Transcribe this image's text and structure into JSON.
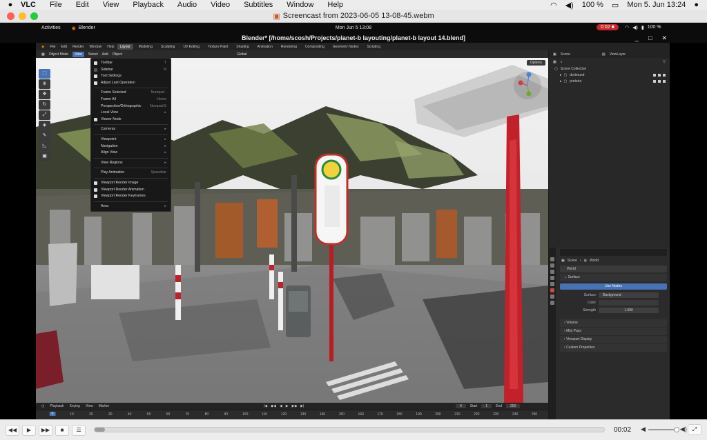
{
  "mac_menubar": {
    "app_name": "VLC",
    "menus": [
      "File",
      "Edit",
      "View",
      "Playback",
      "Audio",
      "Video",
      "Subtitles",
      "Window",
      "Help"
    ],
    "datetime": "Mon 5. Jun  13:24",
    "battery": "100 %"
  },
  "vlc_window": {
    "title": "Screencast from 2023-06-05 13-08-45.webm"
  },
  "gnome_bar": {
    "activities": "Activities",
    "app": "Blender",
    "clock": "Mon Jun 5  13:08",
    "recording": "0:02 ■",
    "battery": "100 %"
  },
  "blender": {
    "title": "Blender* [/home/scosh/Projects/planet-b layouting/planet-b layout 14.blend]",
    "top_menus": [
      "File",
      "Edit",
      "Render",
      "Window",
      "Help"
    ],
    "workspaces": [
      "Layout",
      "Modeling",
      "Sculpting",
      "UV Editing",
      "Texture Paint",
      "Shading",
      "Animation",
      "Rendering",
      "Compositing",
      "Geometry Nodes",
      "Scripting"
    ],
    "active_workspace": "Layout",
    "viewport_header": {
      "mode": "Object Mode",
      "menus": [
        "View",
        "Select",
        "Add",
        "Object"
      ],
      "orientation": "Global",
      "options": "Options"
    },
    "view_menu": {
      "items": [
        {
          "label": "Toolbar",
          "shortcut": "T",
          "check": true
        },
        {
          "label": "Sidebar",
          "shortcut": "N",
          "check": false
        },
        {
          "label": "Tool Settings",
          "shortcut": "",
          "check": true
        },
        {
          "label": "Adjust Last Operation",
          "shortcut": "",
          "check": true
        },
        {
          "label": "Frame Selected",
          "shortcut": "Numpad .",
          "check": null
        },
        {
          "label": "Frame All",
          "shortcut": "Home",
          "check": null
        },
        {
          "label": "Perspective/Orthographic",
          "shortcut": "Numpad 5",
          "check": null
        },
        {
          "label": "Local View",
          "shortcut": "▸",
          "check": null
        },
        {
          "label": "Viewer Node",
          "shortcut": "",
          "check": true
        },
        {
          "label": "Cameras",
          "shortcut": "▸",
          "check": null
        },
        {
          "label": "Viewpoint",
          "shortcut": "▸",
          "check": null
        },
        {
          "label": "Navigation",
          "shortcut": "▸",
          "check": null
        },
        {
          "label": "Align View",
          "shortcut": "▸",
          "check": null
        },
        {
          "label": "View Regions",
          "shortcut": "▸",
          "check": null
        },
        {
          "label": "Play Animation",
          "shortcut": "Spacebar",
          "check": null
        },
        {
          "label": "Viewport Render Image",
          "shortcut": "",
          "check": null
        },
        {
          "label": "Viewport Render Animation",
          "shortcut": "",
          "check": null
        },
        {
          "label": "Viewport Render Keyframes",
          "shortcut": "",
          "check": null
        },
        {
          "label": "Area",
          "shortcut": "▸",
          "check": null
        }
      ]
    },
    "timeline": {
      "menus": [
        "Playback",
        "Keying",
        "View",
        "Marker"
      ],
      "current_frame": "0",
      "start_label": "Start",
      "start": "1",
      "end_label": "End",
      "end": "250",
      "ticks": [
        "0",
        "10",
        "20",
        "30",
        "40",
        "50",
        "60",
        "70",
        "80",
        "90",
        "100",
        "110",
        "120",
        "130",
        "140",
        "150",
        "160",
        "170",
        "180",
        "190",
        "200",
        "210",
        "220",
        "230",
        "240",
        "250"
      ]
    },
    "outliner": {
      "scene": "Scene",
      "view_layer": "ViewLayer",
      "root": "Scene Collection",
      "items": [
        "dortmund",
        "pretoria"
      ]
    },
    "properties": {
      "breadcrumb": [
        "Scene",
        "World"
      ],
      "world_name": "World",
      "surface_panel": "Surface",
      "use_nodes": "Use Nodes",
      "surface_label": "Surface",
      "surface_value": "Background",
      "color_label": "Color",
      "strength_label": "Strength",
      "strength_value": "1.000",
      "panels": [
        "Volume",
        "Mist Pass",
        "Viewport Display",
        "Custom Properties"
      ]
    }
  },
  "vlc_controls": {
    "time": "00:02",
    "progress": 0.02,
    "volume": 0.95
  }
}
